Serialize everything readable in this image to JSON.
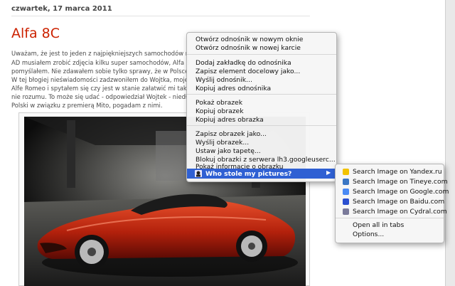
{
  "post": {
    "date": "czwartek, 17 marca 2011",
    "title": "Alfa 8C",
    "lines": [
      "Uważam, że jest to jeden z najpiękniejszych samochodów n",
      "AD musiałem zrobić zdjęcia kilku super samochodów, Alfa 8",
      "pomyślałem. Nie zdawałem sobie tylko sprawy, że w Polsce",
      "W tej błogiej nieświadomości zadzwoniłem do Wojtka, moje",
      "Alfe Romeo i spytałem się czy jest w stanie załatwić mi taki",
      "nie rozumu. To może się udać - odpowiedział Wojtek - niedł",
      "Polski w związku z premierą Mito, pogadam z nimi."
    ]
  },
  "context_menu": {
    "group1": [
      "Otwórz odnośnik w nowym oknie",
      "Otwórz odnośnik w nowej karcie"
    ],
    "group2": [
      "Dodaj zakładkę do odnośnika",
      "Zapisz element docelowy jako...",
      "Wyślij odnośnik...",
      "Kopiuj adres odnośnika"
    ],
    "group3": [
      "Pokaż obrazek",
      "Kopiuj obrazek",
      "Kopiuj adres obrazka"
    ],
    "group4": [
      "Zapisz obrazek jako...",
      "Wyślij obrazek...",
      "Ustaw jako tapetę...",
      "Blokuj obrazki z serwera lh3.googleuserc...",
      "Pokaż informacje o obrazku"
    ],
    "highlighted": "Who stole my pictures?"
  },
  "submenu": {
    "engines": [
      {
        "label": "Search Image on Yandex.ru",
        "color": "#f2c200"
      },
      {
        "label": "Search Image on Tineye.com",
        "color": "#3a76c4"
      },
      {
        "label": "Search Image on Google.com",
        "color": "#4a8af4"
      },
      {
        "label": "Search Image on Baidu.com",
        "color": "#2a4fd0"
      },
      {
        "label": "Search Image on Cydral.com",
        "color": "#7a7a9a"
      }
    ],
    "open_all": "Open all in tabs",
    "options": "Options..."
  },
  "colors": {
    "title_red": "#cc2200",
    "highlight_blue": "#2f60d3",
    "car_red": "#c22a10"
  }
}
